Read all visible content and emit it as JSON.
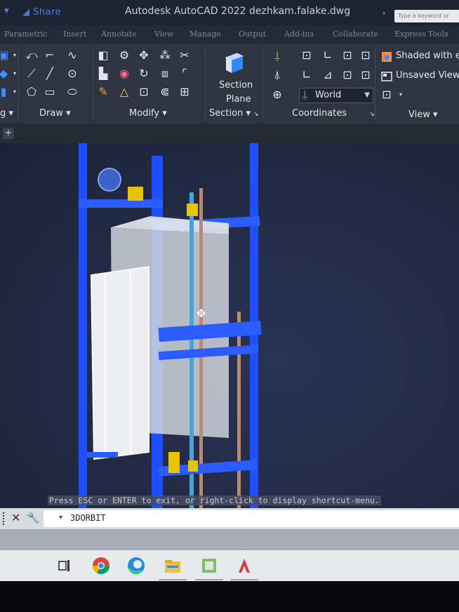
{
  "titlebar": {
    "share": "Share",
    "title": "Autodesk AutoCAD 2022   dezhkam.falake.dwg",
    "search_placeholder": "Type a keyword or phrase"
  },
  "tabs": [
    "Parametric",
    "Insert",
    "Annotate",
    "View",
    "Manage",
    "Output",
    "Add-ins",
    "Collaborate",
    "Express Tools"
  ],
  "ribbon": {
    "panels": {
      "draw": "Draw",
      "modify": "Modify",
      "section": "Section",
      "coordinates": "Coordinates",
      "view": "View"
    },
    "section_plane": {
      "line1": "Section",
      "line2": "Plane"
    },
    "world": "World",
    "view_items": [
      "Shaded with e...",
      "Unsaved View"
    ]
  },
  "viewport": {
    "hint": "Press ESC or ENTER to exit, or right-click to display shortcut-menu."
  },
  "command_line": {
    "value": "3DORBIT"
  },
  "colors": {
    "accent": "#1e5cff",
    "frame_blue": "#1f4fff",
    "viewport_bg": "#222a45"
  }
}
